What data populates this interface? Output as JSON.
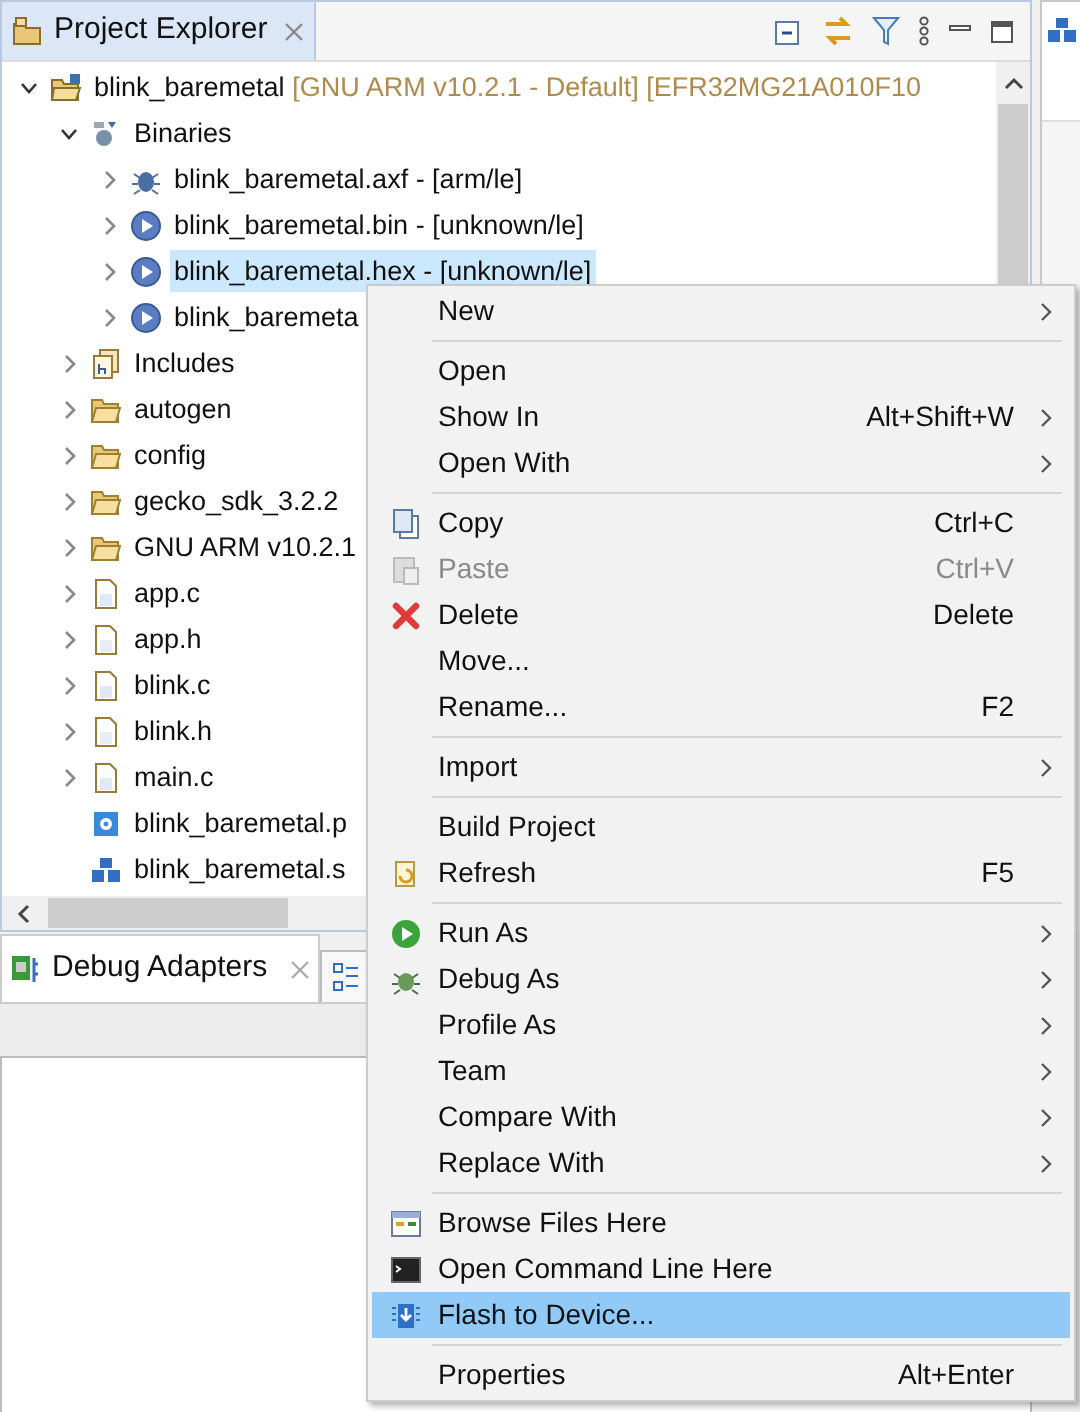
{
  "project_explorer": {
    "title": "Project Explorer",
    "tree": [
      {
        "kind": "project",
        "label": "blink_baremetal",
        "decoration": "[GNU ARM v10.2.1 - Default] [EFR32MG21A010F10",
        "expanded": true,
        "selected": false,
        "children": [
          {
            "kind": "binaries",
            "label": "Binaries",
            "expanded": true,
            "selected": false,
            "children": [
              {
                "kind": "elf",
                "label": "blink_baremetal.axf - [arm/le]",
                "expanded": false,
                "selected": false
              },
              {
                "kind": "binary",
                "label": "blink_baremetal.bin - [unknown/le]",
                "expanded": false,
                "selected": false
              },
              {
                "kind": "binary",
                "label": "blink_baremetal.hex - [unknown/le]",
                "expanded": false,
                "selected": true
              },
              {
                "kind": "binary",
                "label": "blink_baremeta",
                "expanded": false,
                "selected": false
              }
            ]
          },
          {
            "kind": "includes",
            "label": "Includes",
            "expanded": false,
            "selected": false
          },
          {
            "kind": "folder",
            "label": "autogen",
            "expanded": false,
            "selected": false
          },
          {
            "kind": "folder",
            "label": "config",
            "expanded": false,
            "selected": false
          },
          {
            "kind": "folder",
            "label": "gecko_sdk_3.2.2",
            "expanded": false,
            "selected": false
          },
          {
            "kind": "folder",
            "label": "GNU ARM v10.2.1",
            "expanded": false,
            "selected": false
          },
          {
            "kind": "c-file",
            "label": "app.c",
            "expanded": false,
            "selected": false
          },
          {
            "kind": "h-file",
            "label": "app.h",
            "expanded": false,
            "selected": false
          },
          {
            "kind": "c-file",
            "label": "blink.c",
            "expanded": false,
            "selected": false
          },
          {
            "kind": "h-file",
            "label": "blink.h",
            "expanded": false,
            "selected": false
          },
          {
            "kind": "c-file",
            "label": "main.c",
            "expanded": false,
            "selected": false
          },
          {
            "kind": "config",
            "label": "blink_baremetal.p",
            "selected": false
          },
          {
            "kind": "solution",
            "label": "blink_baremetal.s",
            "selected": false
          }
        ]
      }
    ]
  },
  "debug_adapters": {
    "title": "Debug Adapters"
  },
  "context_menu": [
    {
      "kind": "item",
      "label": "New",
      "submenu": true,
      "disabled": false,
      "selected": false
    },
    {
      "kind": "separator"
    },
    {
      "kind": "item",
      "label": "Open",
      "submenu": false,
      "disabled": false,
      "selected": false
    },
    {
      "kind": "item",
      "label": "Show In",
      "shortcut": "Alt+Shift+W",
      "submenu": true,
      "disabled": false,
      "selected": false
    },
    {
      "kind": "item",
      "label": "Open With",
      "submenu": true,
      "disabled": false,
      "selected": false
    },
    {
      "kind": "separator"
    },
    {
      "kind": "item",
      "label": "Copy",
      "shortcut": "Ctrl+C",
      "submenu": false,
      "disabled": false,
      "selected": false
    },
    {
      "kind": "item",
      "label": "Paste",
      "shortcut": "Ctrl+V",
      "submenu": false,
      "disabled": true,
      "selected": false
    },
    {
      "kind": "item",
      "label": "Delete",
      "shortcut": "Delete",
      "submenu": false,
      "disabled": false,
      "selected": false
    },
    {
      "kind": "item",
      "label": "Move...",
      "submenu": false,
      "disabled": false,
      "selected": false
    },
    {
      "kind": "item",
      "label": "Rename...",
      "shortcut": "F2",
      "submenu": false,
      "disabled": false,
      "selected": false
    },
    {
      "kind": "separator"
    },
    {
      "kind": "item",
      "label": "Import",
      "submenu": true,
      "disabled": false,
      "selected": false
    },
    {
      "kind": "separator"
    },
    {
      "kind": "item",
      "label": "Build Project",
      "submenu": false,
      "disabled": false,
      "selected": false
    },
    {
      "kind": "item",
      "label": "Refresh",
      "shortcut": "F5",
      "submenu": false,
      "disabled": false,
      "selected": false
    },
    {
      "kind": "separator"
    },
    {
      "kind": "item",
      "label": "Run As",
      "submenu": true,
      "disabled": false,
      "selected": false
    },
    {
      "kind": "item",
      "label": "Debug As",
      "submenu": true,
      "disabled": false,
      "selected": false
    },
    {
      "kind": "item",
      "label": "Profile As",
      "submenu": true,
      "disabled": false,
      "selected": false
    },
    {
      "kind": "item",
      "label": "Team",
      "submenu": true,
      "disabled": false,
      "selected": false
    },
    {
      "kind": "item",
      "label": "Compare With",
      "submenu": true,
      "disabled": false,
      "selected": false
    },
    {
      "kind": "item",
      "label": "Replace With",
      "submenu": true,
      "disabled": false,
      "selected": false
    },
    {
      "kind": "separator"
    },
    {
      "kind": "item",
      "label": "Browse Files Here",
      "submenu": false,
      "disabled": false,
      "selected": false
    },
    {
      "kind": "item",
      "label": "Open Command Line Here",
      "submenu": false,
      "disabled": false,
      "selected": false
    },
    {
      "kind": "item",
      "label": "Flash to Device...",
      "submenu": false,
      "disabled": false,
      "selected": true
    },
    {
      "kind": "separator"
    },
    {
      "kind": "item",
      "label": "Properties",
      "shortcut": "Alt+Enter",
      "submenu": false,
      "disabled": false,
      "selected": false
    }
  ]
}
